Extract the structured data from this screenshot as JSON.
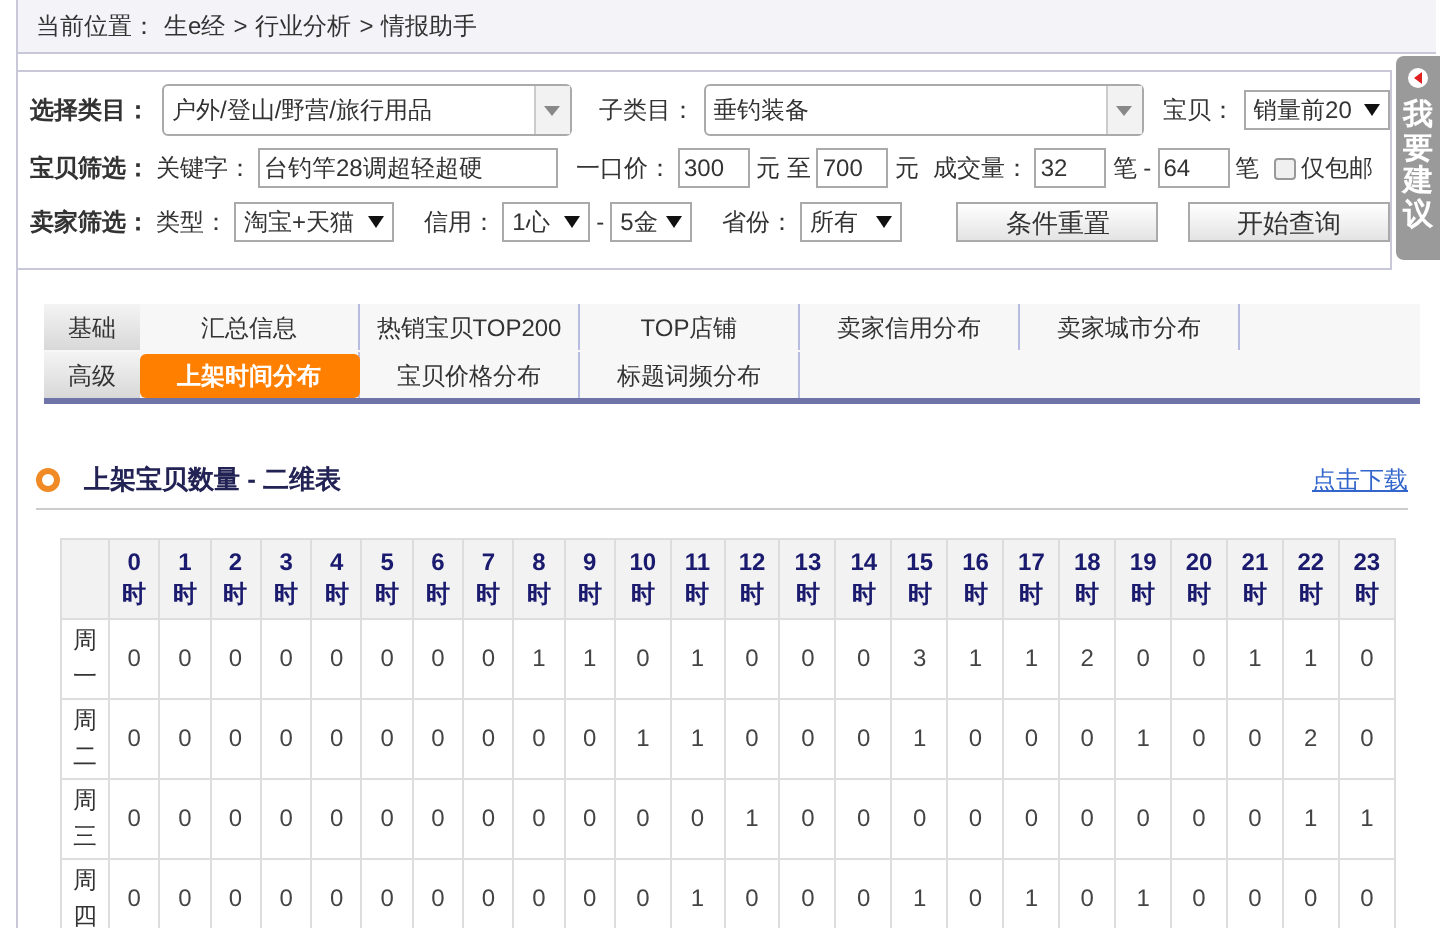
{
  "breadcrumb": {
    "label": "当前位置：",
    "items": [
      "生e经",
      "行业分析",
      "情报助手"
    ],
    "separator": ">"
  },
  "filters": {
    "category": {
      "label": "选择类目：",
      "value": "户外/登山/野营/旅行用品"
    },
    "subcategory": {
      "label": "子类目：",
      "value": "垂钓装备"
    },
    "item": {
      "label": "宝贝：",
      "value": "销量前20"
    },
    "item_filter": {
      "label": "宝贝筛选：",
      "keyword_label": "关键字：",
      "keyword": "台钓竿28调超轻超硬",
      "price_label": "一口价：",
      "price_min": "300",
      "price_to": "元 至",
      "price_max": "700",
      "price_unit": "元",
      "sales_label": "成交量：",
      "sales_min": "32",
      "sales_unit_1": "笔 -",
      "sales_max": "64",
      "sales_unit_2": "笔",
      "free_shipping": {
        "label": "仅包邮",
        "checked": false
      }
    },
    "seller_filter": {
      "label": "卖家筛选：",
      "type_label": "类型：",
      "type": "淘宝+天猫",
      "credit_label": "信用：",
      "credit_min": "1心",
      "credit_dash": "-",
      "credit_max": "5金",
      "province_label": "省份：",
      "province": "所有"
    },
    "buttons": [
      "条件重置",
      "开始查询"
    ]
  },
  "feedback_tab": "我要建议",
  "tab_rows": [
    {
      "label": "基础",
      "tabs": [
        {
          "label": "汇总信息",
          "selected": false
        },
        {
          "label": "热销宝贝TOP200",
          "selected": false
        },
        {
          "label": "TOP店铺",
          "selected": false
        },
        {
          "label": "卖家信用分布",
          "selected": false
        },
        {
          "label": "卖家城市分布",
          "selected": false
        }
      ]
    },
    {
      "label": "高级",
      "tabs": [
        {
          "label": "上架时间分布",
          "selected": true
        },
        {
          "label": "宝贝价格分布",
          "selected": false
        },
        {
          "label": "标题词频分布",
          "selected": false
        }
      ]
    }
  ],
  "section": {
    "title": "上架宝贝数量 - 二维表",
    "download_link": "点击下载"
  },
  "table": {
    "columns": [
      {
        "hour": "0",
        "unit": "时"
      },
      {
        "hour": "1",
        "unit": "时"
      },
      {
        "hour": "2",
        "unit": "时"
      },
      {
        "hour": "3",
        "unit": "时"
      },
      {
        "hour": "4",
        "unit": "时"
      },
      {
        "hour": "5",
        "unit": "时"
      },
      {
        "hour": "6",
        "unit": "时"
      },
      {
        "hour": "7",
        "unit": "时"
      },
      {
        "hour": "8",
        "unit": "时"
      },
      {
        "hour": "9",
        "unit": "时"
      },
      {
        "hour": "10",
        "unit": "时"
      },
      {
        "hour": "11",
        "unit": "时"
      },
      {
        "hour": "12",
        "unit": "时"
      },
      {
        "hour": "13",
        "unit": "时"
      },
      {
        "hour": "14",
        "unit": "时"
      },
      {
        "hour": "15",
        "unit": "时"
      },
      {
        "hour": "16",
        "unit": "时"
      },
      {
        "hour": "17",
        "unit": "时"
      },
      {
        "hour": "18",
        "unit": "时"
      },
      {
        "hour": "19",
        "unit": "时"
      },
      {
        "hour": "20",
        "unit": "时"
      },
      {
        "hour": "21",
        "unit": "时"
      },
      {
        "hour": "22",
        "unit": "时"
      },
      {
        "hour": "23",
        "unit": "时"
      }
    ],
    "rows": [
      {
        "day": "周一",
        "values": [
          "0",
          "0",
          "0",
          "0",
          "0",
          "0",
          "0",
          "0",
          "1",
          "1",
          "0",
          "1",
          "0",
          "0",
          "0",
          "3",
          "1",
          "1",
          "2",
          "0",
          "0",
          "1",
          "1",
          "0"
        ]
      },
      {
        "day": "周二",
        "values": [
          "0",
          "0",
          "0",
          "0",
          "0",
          "0",
          "0",
          "0",
          "0",
          "0",
          "1",
          "1",
          "0",
          "0",
          "0",
          "1",
          "0",
          "0",
          "0",
          "1",
          "0",
          "0",
          "2",
          "0"
        ]
      },
      {
        "day": "周三",
        "values": [
          "0",
          "0",
          "0",
          "0",
          "0",
          "0",
          "0",
          "0",
          "0",
          "0",
          "0",
          "0",
          "1",
          "0",
          "0",
          "0",
          "0",
          "0",
          "0",
          "0",
          "0",
          "0",
          "1",
          "1"
        ]
      },
      {
        "day": "周四",
        "values": [
          "0",
          "0",
          "0",
          "0",
          "0",
          "0",
          "0",
          "0",
          "0",
          "0",
          "0",
          "1",
          "0",
          "0",
          "0",
          "1",
          "0",
          "1",
          "0",
          "1",
          "0",
          "0",
          "0",
          "0"
        ]
      }
    ]
  }
}
